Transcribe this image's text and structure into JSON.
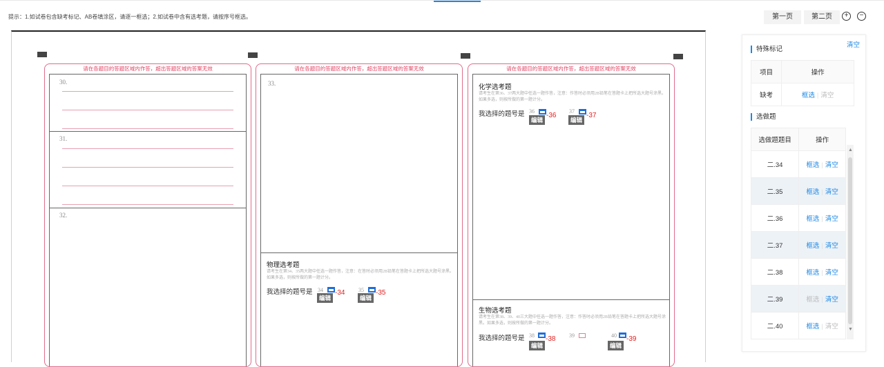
{
  "hint_text": "提示：1.如试卷包含缺考标记、AB卷填涂区，请逐一框选；2.如试卷中含有选考题，请按序号框选。",
  "pager": {
    "first_page": "第一页",
    "second_page": "第二页",
    "zoom_in_icon": "plus-circle-icon",
    "zoom_out_icon": "minus-circle-icon"
  },
  "sheet": {
    "column_header": "请在各题目的答题区域内作答，超出答题区域的答案无效",
    "col1": {
      "q30": "30.",
      "q31": "31.",
      "q32": "32."
    },
    "col2": {
      "q33": "33.",
      "physics": {
        "title": "物理选考题",
        "desc": "请考生在第34、35两大题中任选一题作答，注意：在答时必须用2B铅笔在答题卡上把所选大题号涂黑。如果多选，则按所做的第一题计分。",
        "choose": "我选择的题号是",
        "opt1": "34",
        "opt2": "35",
        "label1": "-34",
        "label2": "-35",
        "edit": "编辑"
      }
    },
    "col3": {
      "chemistry": {
        "title": "化学选考题",
        "desc": "请考生在第36、37两大题中任选一题作答，注意：作答时必须用2B铅笔在答题卡上把所选大题号涂黑。如果多选，则按所做的第一题计分。",
        "choose": "我选择的题号是",
        "opt1": "36",
        "opt2": "37",
        "label1": "-36",
        "label2": "-37",
        "edit": "编辑"
      },
      "biology": {
        "title": "生物选考题",
        "desc": "请考生在第38、39、40三大题中任选一题作答，注意：作答时必须用2B铅笔在答题卡上把所选大题号涂黑。如果多选，则按所做的第一题计分。",
        "choose": "我选择的题号是",
        "opt1": "38",
        "opt2": "39",
        "opt3": "40",
        "label1": "-38",
        "label3": "-39",
        "edit": "编辑"
      }
    }
  },
  "panel": {
    "special_title": "特殊标记",
    "clear_all": "清空",
    "special_table": {
      "headers": [
        "项目",
        "操作"
      ],
      "rows": [
        {
          "item": "缺考",
          "select": "框选",
          "clear": "清空"
        }
      ]
    },
    "elective_title": "选做题",
    "elective_table": {
      "headers": [
        "选做题题目",
        "操作"
      ],
      "rows": [
        {
          "item": "二.34",
          "select": "框选",
          "clear": "清空"
        },
        {
          "item": "二.35",
          "select": "框选",
          "clear": "清空"
        },
        {
          "item": "二.36",
          "select": "框选",
          "clear": "清空"
        },
        {
          "item": "二.37",
          "select": "框选",
          "clear": "清空"
        },
        {
          "item": "二.38",
          "select": "框选",
          "clear": "清空"
        },
        {
          "item": "二.39",
          "select": "框选",
          "clear": "清空"
        },
        {
          "item": "二.40",
          "select": "框选",
          "clear": "清空"
        }
      ]
    }
  },
  "colors": {
    "accent": "#1e88e5",
    "sheet_border": "#e06a8a",
    "red_label": "#e02020"
  }
}
